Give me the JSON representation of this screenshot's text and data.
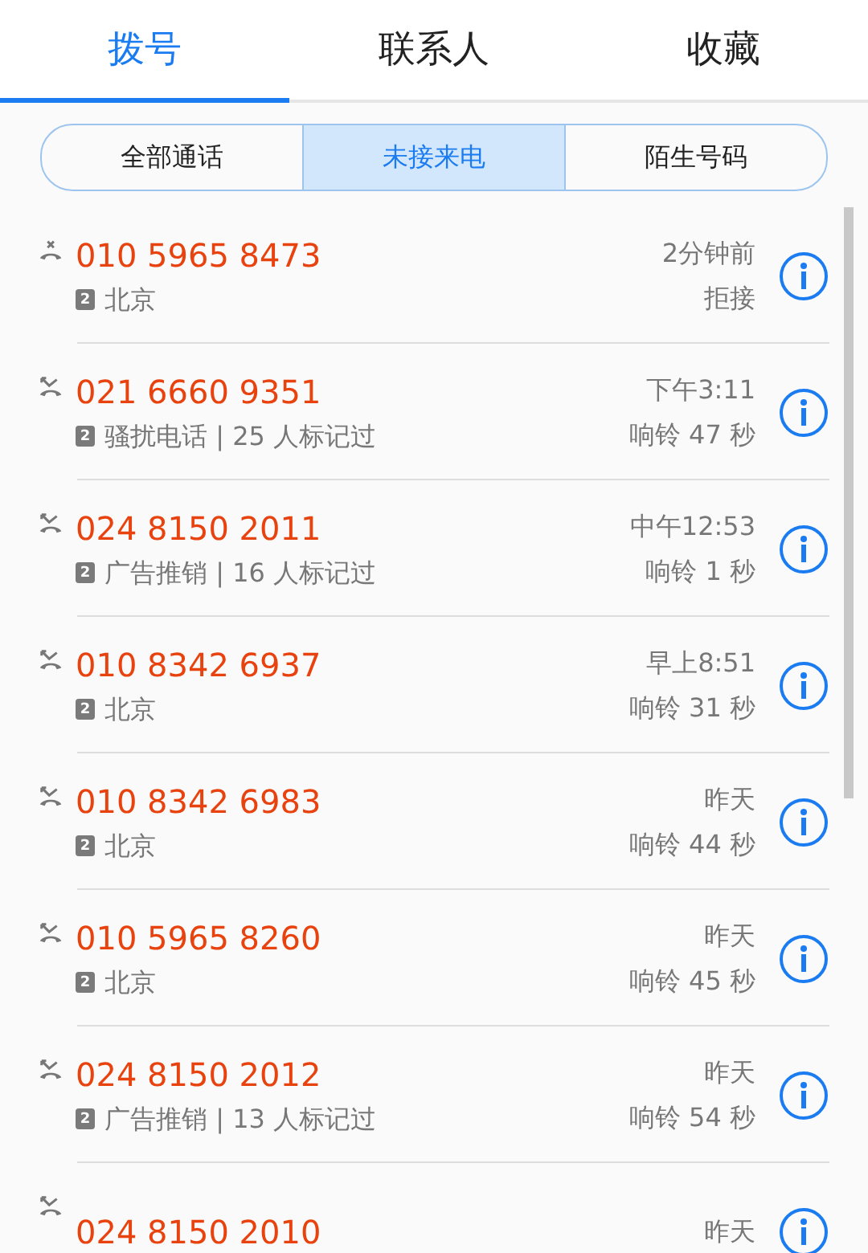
{
  "tabs": [
    {
      "label": "拨号",
      "selected": true
    },
    {
      "label": "联系人",
      "selected": false
    },
    {
      "label": "收藏",
      "selected": false
    }
  ],
  "filters": [
    {
      "label": "全部通话",
      "selected": false
    },
    {
      "label": "未接来电",
      "selected": true
    },
    {
      "label": "陌生号码",
      "selected": false
    }
  ],
  "calls": [
    {
      "kind": "rejected",
      "number": "010 5965 8473",
      "sim": "2",
      "info": "北京",
      "time": "2分钟前",
      "detail": "拒接"
    },
    {
      "kind": "missed",
      "number": "021 6660 9351",
      "sim": "2",
      "info": "骚扰电话 | 25 人标记过",
      "time": "下午3:11",
      "detail": "响铃 47 秒"
    },
    {
      "kind": "missed",
      "number": "024 8150 2011",
      "sim": "2",
      "info": "广告推销 | 16 人标记过",
      "time": "中午12:53",
      "detail": "响铃 1 秒"
    },
    {
      "kind": "missed",
      "number": "010 8342 6937",
      "sim": "2",
      "info": "北京",
      "time": "早上8:51",
      "detail": "响铃 31 秒"
    },
    {
      "kind": "missed",
      "number": "010 8342 6983",
      "sim": "2",
      "info": "北京",
      "time": "昨天",
      "detail": "响铃 44 秒"
    },
    {
      "kind": "missed",
      "number": "010 5965 8260",
      "sim": "2",
      "info": "北京",
      "time": "昨天",
      "detail": "响铃 45 秒"
    },
    {
      "kind": "missed",
      "number": "024 8150 2012",
      "sim": "2",
      "info": "广告推销 | 13 人标记过",
      "time": "昨天",
      "detail": "响铃 54 秒"
    },
    {
      "kind": "missed",
      "number": "024 8150 2010",
      "time": "昨天"
    }
  ]
}
